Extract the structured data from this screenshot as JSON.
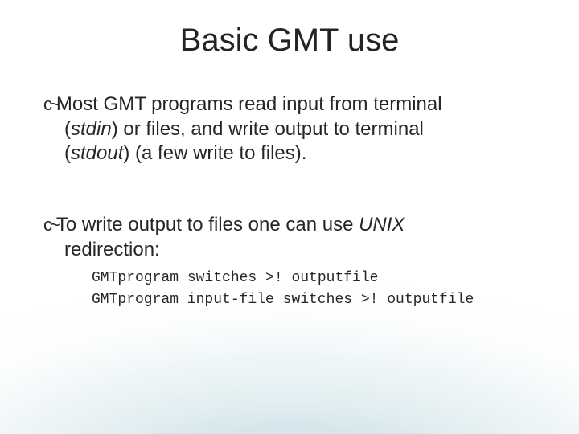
{
  "title": "Basic GMT use",
  "bullet1": {
    "lead": "Most  GMT programs read input from terminal",
    "line2a": "(",
    "line2_stdin": "stdin",
    "line2b": ") or files, and write output to terminal",
    "line3a": "(",
    "line3_stdout": "stdout",
    "line3b": ") (a few write to files)."
  },
  "bullet2": {
    "lead_a": "To write output to files one can use ",
    "lead_unix": "UNIX",
    "cont": "redirection:"
  },
  "code": {
    "line1": "GMTprogram switches >! outputfile",
    "line2": "GMTprogram input-file switches >! outputfile"
  }
}
